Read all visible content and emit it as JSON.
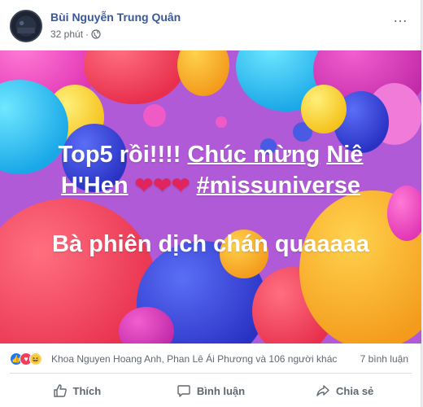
{
  "post": {
    "author": "Bùi Nguyễn Trung Quân",
    "time": "32 phút",
    "time_separator": "·",
    "more_icon": "…"
  },
  "overlay": {
    "line1_a": "Top5 rồi!!!! ",
    "line1_b": "Chúc mừng",
    "line1_c": " ",
    "line1_d": "Niê",
    "line2_a": "H'Hen",
    "hearts": "❤❤❤",
    "line2_c": "#missuniverse",
    "line3": "Bà phiên dịch chán quaaaaa"
  },
  "reactions": {
    "names": "Khoa Nguyen Hoang Anh, Phan Lê Ái Phương và 106 người khác",
    "comments": "7 bình luận",
    "like_glyph": "👍",
    "love_glyph": "♥",
    "haha_glyph": "😆"
  },
  "actions": {
    "like": "Thích",
    "comment": "Bình luận",
    "share": "Chia sẻ"
  },
  "colors": {
    "author": "#385898",
    "meta": "#616770",
    "like_blue": "#2078f4",
    "love_red": "#f33e58"
  }
}
